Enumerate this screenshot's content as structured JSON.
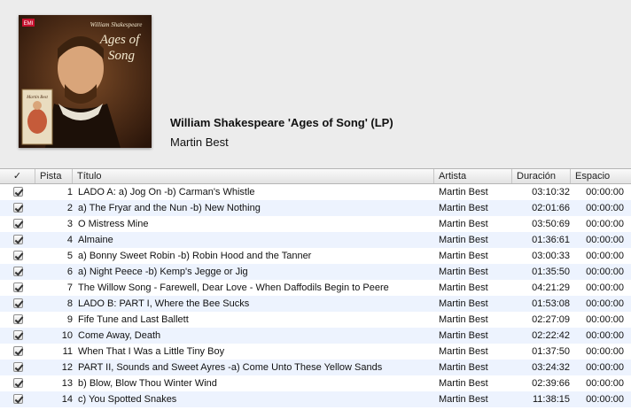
{
  "album": {
    "title": "William Shakespeare 'Ages of Song' (LP)",
    "artist": "Martin Best",
    "cover": {
      "label_top": "William Shakespeare",
      "label_main1": "Ages of",
      "label_main2": "Song",
      "label_artist": "Martin Best",
      "badge": "EMI"
    }
  },
  "columns": {
    "check": "✓",
    "track": "Pista",
    "title": "Título",
    "artist": "Artista",
    "duration": "Duración",
    "space": "Espacio"
  },
  "tracks": [
    {
      "num": "1",
      "title": "LADO A: a) Jog On -b) Carman's Whistle",
      "artist": "Martin Best",
      "duration": "03:10:32",
      "space": "00:00:00"
    },
    {
      "num": "2",
      "title": "a) The Fryar and the Nun -b) New Nothing",
      "artist": "Martin Best",
      "duration": "02:01:66",
      "space": "00:00:00"
    },
    {
      "num": "3",
      "title": "O Mistress Mine",
      "artist": "Martin Best",
      "duration": "03:50:69",
      "space": "00:00:00"
    },
    {
      "num": "4",
      "title": "Almaine",
      "artist": "Martin Best",
      "duration": "01:36:61",
      "space": "00:00:00"
    },
    {
      "num": "5",
      "title": "a) Bonny Sweet Robin -b) Robin Hood and the Tanner",
      "artist": "Martin Best",
      "duration": "03:00:33",
      "space": "00:00:00"
    },
    {
      "num": "6",
      "title": "a) Night Peece -b) Kemp's Jegge or Jig",
      "artist": "Martin Best",
      "duration": "01:35:50",
      "space": "00:00:00"
    },
    {
      "num": "7",
      "title": "The Willow Song - Farewell, Dear Love - When Daffodils Begin to Peere",
      "artist": "Martin Best",
      "duration": "04:21:29",
      "space": "00:00:00"
    },
    {
      "num": "8",
      "title": "LADO B: PART I, Where the Bee Sucks",
      "artist": "Martin Best",
      "duration": "01:53:08",
      "space": "00:00:00"
    },
    {
      "num": "9",
      "title": "Fife Tune and Last Ballett",
      "artist": "Martin Best",
      "duration": "02:27:09",
      "space": "00:00:00"
    },
    {
      "num": "10",
      "title": "Come Away, Death",
      "artist": "Martin Best",
      "duration": "02:22:42",
      "space": "00:00:00"
    },
    {
      "num": "11",
      "title": "When That I Was a Little Tiny Boy",
      "artist": "Martin Best",
      "duration": "01:37:50",
      "space": "00:00:00"
    },
    {
      "num": "12",
      "title": "PART II, Sounds and Sweet Ayres -a) Come Unto These Yellow Sands",
      "artist": "Martin Best",
      "duration": "03:24:32",
      "space": "00:00:00"
    },
    {
      "num": "13",
      "title": "b) Blow, Blow Thou Winter Wind",
      "artist": "Martin Best",
      "duration": "02:39:66",
      "space": "00:00:00"
    },
    {
      "num": "14",
      "title": "c) You Spotted Snakes",
      "artist": "Martin Best",
      "duration": "11:38:15",
      "space": "00:00:00"
    }
  ]
}
